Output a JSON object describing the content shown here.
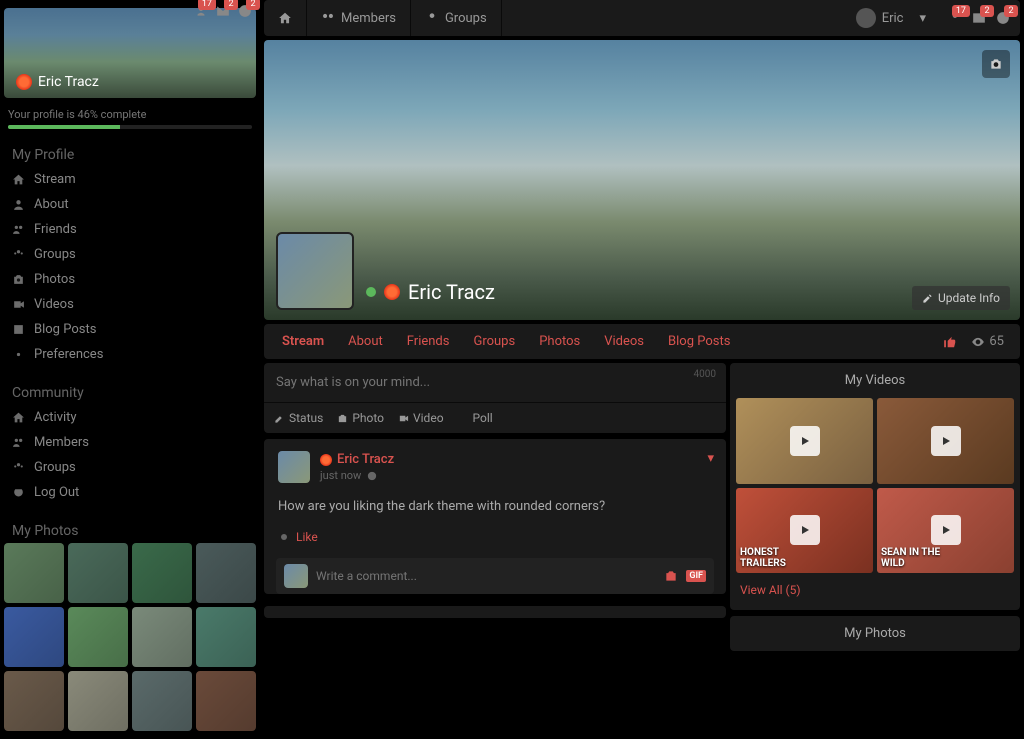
{
  "topbar": {
    "nav": {
      "home": "",
      "members": "Members",
      "groups": "Groups"
    },
    "user": {
      "name": "Eric"
    },
    "badges": {
      "friends": "17",
      "messages": "2",
      "notifications": "2"
    }
  },
  "sidebar": {
    "badges": {
      "friends": "17",
      "messages": "2",
      "notifications": "2"
    },
    "user_name": "Eric Tracz",
    "progress": {
      "label": "Your profile is 46% complete",
      "percent": 46
    },
    "profile_title": "My Profile",
    "profile_items": [
      {
        "icon": "home",
        "label": "Stream"
      },
      {
        "icon": "user",
        "label": "About"
      },
      {
        "icon": "users",
        "label": "Friends"
      },
      {
        "icon": "group",
        "label": "Groups"
      },
      {
        "icon": "camera",
        "label": "Photos"
      },
      {
        "icon": "video",
        "label": "Videos"
      },
      {
        "icon": "blog",
        "label": "Blog Posts"
      },
      {
        "icon": "gear",
        "label": "Preferences"
      }
    ],
    "community_title": "Community",
    "community_items": [
      {
        "icon": "home",
        "label": "Activity"
      },
      {
        "icon": "users",
        "label": "Members"
      },
      {
        "icon": "group",
        "label": "Groups"
      },
      {
        "icon": "power",
        "label": "Log Out"
      }
    ],
    "photos_title": "My Photos"
  },
  "profile": {
    "name": "Eric Tracz",
    "update_info": "Update Info",
    "tabs": [
      "Stream",
      "About",
      "Friends",
      "Groups",
      "Photos",
      "Videos",
      "Blog Posts"
    ],
    "views": "65"
  },
  "composer": {
    "placeholder": "Say what is on your mind...",
    "char_count": "4000",
    "options": {
      "status": "Status",
      "photo": "Photo",
      "video": "Video",
      "poll": "Poll"
    }
  },
  "post": {
    "author": "Eric Tracz",
    "time": "just now",
    "body": "How are you liking the dark theme with rounded corners?",
    "like": "Like",
    "comment_placeholder": "Write a comment...",
    "gif": "GIF"
  },
  "widgets": {
    "videos_title": "My Videos",
    "video_overlays": [
      "",
      "",
      "HONEST\nTRAILERS",
      "SEAN IN THE\nWILD"
    ],
    "view_all": "View All (5)",
    "photos_title": "My Photos"
  }
}
